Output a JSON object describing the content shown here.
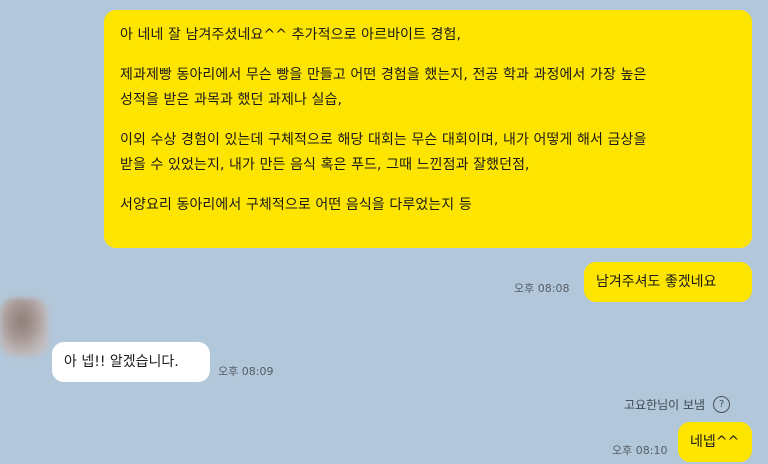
{
  "messages": {
    "long_message": {
      "lines": [
        "아 네네 잘 남겨주셨네요^^ 추가적으로 아르바이트 경험,",
        "제과제빵 동아리에서 무슨 빵을 만들고 어떤 경험을 했는지, 전공 학과 과정에서 가장 높은",
        "성적을 받은 과목과 했던 과제나 실습,",
        "이외 수상 경험이 있는데 구체적으로 해당 대회는 무슨 대회이며, 내가 어떻게 해서 금상을",
        "받을 수 있었는지, 내가 만든 음식 혹은 푸드, 그때 느낀점과 잘했던점,",
        "서양요리 동아리에서 구체적으로 어떤 음식을 다루었는지 등"
      ]
    },
    "msg_leave_it": {
      "text": "남겨주셔도 좋겠네요",
      "time": "오후 08:08"
    },
    "msg_reply": {
      "text": "아 넵!! 알겠습니다.",
      "time": "오후 08:09"
    },
    "sender_note": "고요한님이 보냄",
    "msg_final": {
      "text": "네넵^^",
      "time": "오후 08:10"
    }
  },
  "colors": {
    "background": "#b2c7d9",
    "my_bubble": "#fee500",
    "their_bubble": "#ffffff"
  },
  "icons": {
    "help": "question-circle-icon",
    "avatar": "blurred-profile-avatar"
  }
}
